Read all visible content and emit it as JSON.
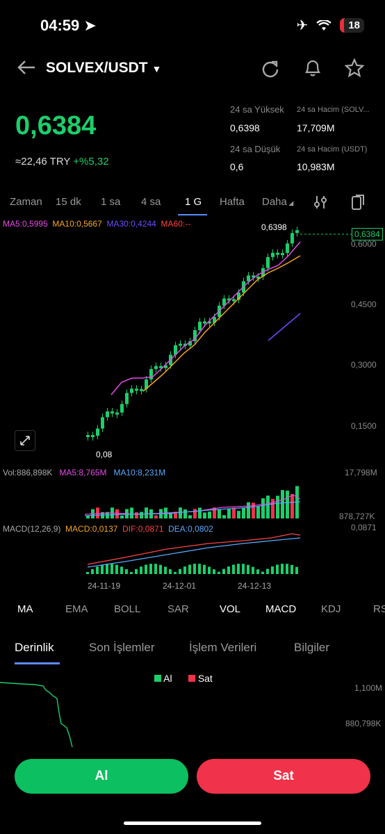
{
  "status": {
    "time": "04:59",
    "battery": "18"
  },
  "header": {
    "pair": "SOLVEX/USDT"
  },
  "price": {
    "last": "0,6384",
    "try_equiv": "≈22,46 TRY",
    "change": "+%5,32"
  },
  "stats": {
    "high_label": "24 sa Yüksek",
    "high": "0,6398",
    "low_label": "24 sa Düşük",
    "low": "0,6",
    "vol_base_label": "24 sa Hacim (SOLV...",
    "vol_base": "17,709M",
    "vol_quote_label": "24 sa Hacim (USDT)",
    "vol_quote": "10,983M"
  },
  "timeframes": [
    "Zaman",
    "15 dk",
    "1 sa",
    "4 sa",
    "1 G",
    "Hafta",
    "Daha"
  ],
  "ma_legend": {
    "ma5": "MA5:0,5995",
    "ma10": "MA10:0,5667",
    "ma30": "MA30:0,4244",
    "ma60": "MA60:--"
  },
  "price_axis": [
    "0,6000",
    "0,4500",
    "0,3000",
    "0,1500"
  ],
  "last_tag": "0,6384",
  "high_marker": "0,6398",
  "low_marker": "0,08",
  "volume": {
    "label": "Vol:886,898K",
    "ma5": "MA5:8,765M",
    "ma10": "MA10:8,231M",
    "axis_top": "17,798M",
    "axis_bottom": "878,727K"
  },
  "macd": {
    "label": "MACD(12,26,9)",
    "macd": "MACD:0,0137",
    "dif": "DIF:0,0871",
    "dea": "DEA:0,0802",
    "axis": "0,0871"
  },
  "dates": [
    "24-11-19",
    "24-12-01",
    "24-12-13"
  ],
  "indicators": [
    "MA",
    "EMA",
    "BOLL",
    "SAR",
    "VOL",
    "MACD",
    "KDJ",
    "RS"
  ],
  "sections": [
    "Derinlik",
    "Son İşlemler",
    "İşlem Verileri",
    "Bilgiler"
  ],
  "depth": {
    "buy": "Al",
    "sell": "Sat",
    "axis_top": "1,100M",
    "axis_mid": "880,798K"
  },
  "actions": {
    "buy": "Al",
    "sell": "Sat"
  },
  "colors": {
    "up": "#1bcf6b",
    "down": "#f0324a",
    "ma5": "#e64ce6",
    "ma10": "#f6a623",
    "ma30": "#6a4cff",
    "ma60": "#ff4444",
    "accent": "#5a8cff"
  }
}
